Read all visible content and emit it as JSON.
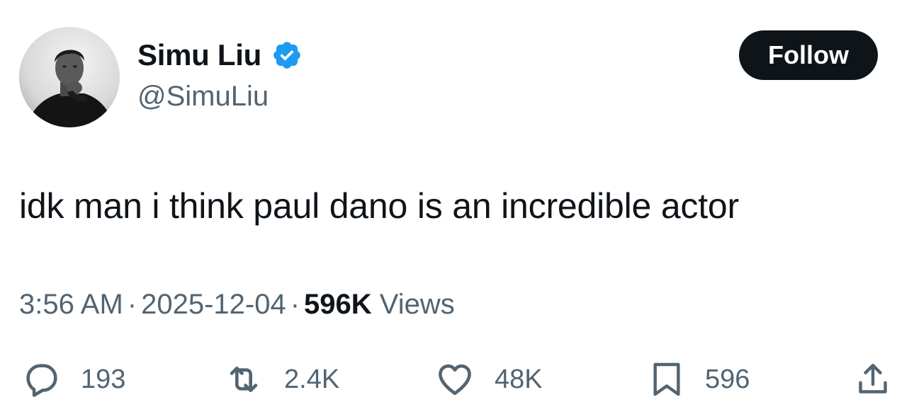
{
  "author": {
    "display_name": "Simu Liu",
    "handle": "@SimuLiu",
    "verified": true,
    "verified_color": "#1d9bf0",
    "avatar_icon": "profile-photo"
  },
  "follow_button": {
    "label": "Follow"
  },
  "tweet": {
    "text": "idk man i think paul dano is an incredible actor",
    "time": "3:56 AM",
    "date": "2025-12-04",
    "separator": "·",
    "views_count": "596K",
    "views_label": "Views"
  },
  "actions": {
    "reply_count": "193",
    "retweet_count": "2.4K",
    "like_count": "48K",
    "bookmark_count": "596",
    "icons": [
      "reply-icon",
      "retweet-icon",
      "like-icon",
      "bookmark-icon",
      "share-icon"
    ]
  },
  "colors": {
    "text_primary": "#0f1419",
    "text_secondary": "#536471",
    "button_bg": "#0f1419",
    "button_text": "#ffffff"
  }
}
